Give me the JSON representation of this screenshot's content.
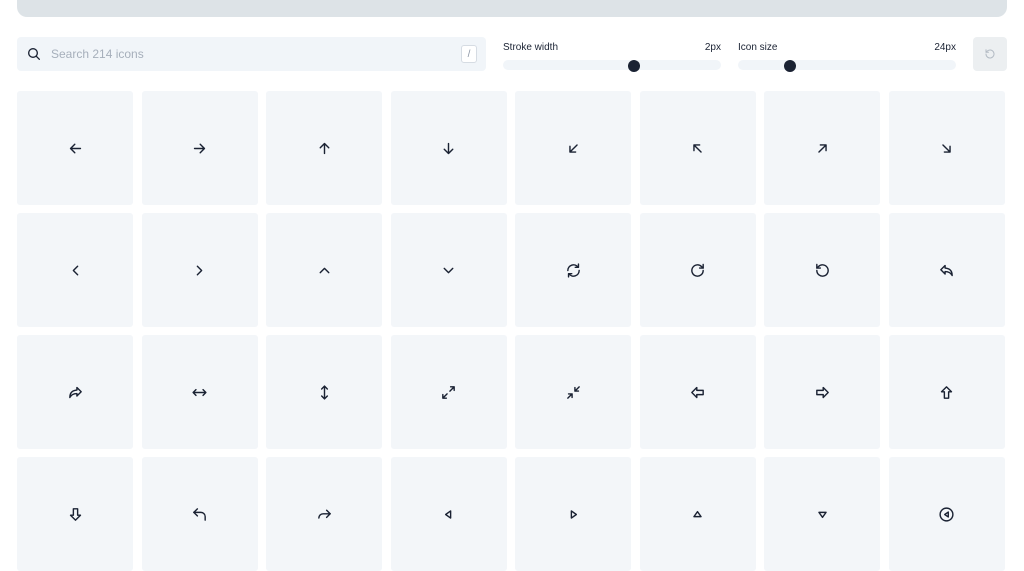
{
  "search": {
    "placeholder": "Search 214 icons",
    "value": "",
    "shortcut": "/"
  },
  "controls": {
    "stroke_width": {
      "label": "Stroke width",
      "value_text": "2px",
      "value": 2,
      "fraction": 0.6
    },
    "icon_size": {
      "label": "Icon size",
      "value_text": "24px",
      "value": 24,
      "fraction": 0.24
    }
  },
  "icons": [
    "arrow-left-icon",
    "arrow-right-icon",
    "arrow-up-icon",
    "arrow-down-icon",
    "arrow-down-left-icon",
    "arrow-up-left-icon",
    "arrow-up-right-icon",
    "arrow-down-right-icon",
    "chevron-left-icon",
    "chevron-right-icon",
    "chevron-up-icon",
    "chevron-down-icon",
    "refresh-icon",
    "rotate-cw-icon",
    "rotate-ccw-icon",
    "reply-icon",
    "forward-icon",
    "arrows-horizontal-icon",
    "arrows-vertical-icon",
    "expand-icon",
    "shrink-icon",
    "arrow-big-left-icon",
    "arrow-big-right-icon",
    "arrow-big-up-icon",
    "arrow-big-down-icon",
    "corner-up-left-icon",
    "corner-up-right-icon",
    "triangle-left-icon",
    "triangle-right-icon",
    "triangle-up-icon",
    "triangle-down-icon",
    "circle-arrow-left-icon"
  ]
}
